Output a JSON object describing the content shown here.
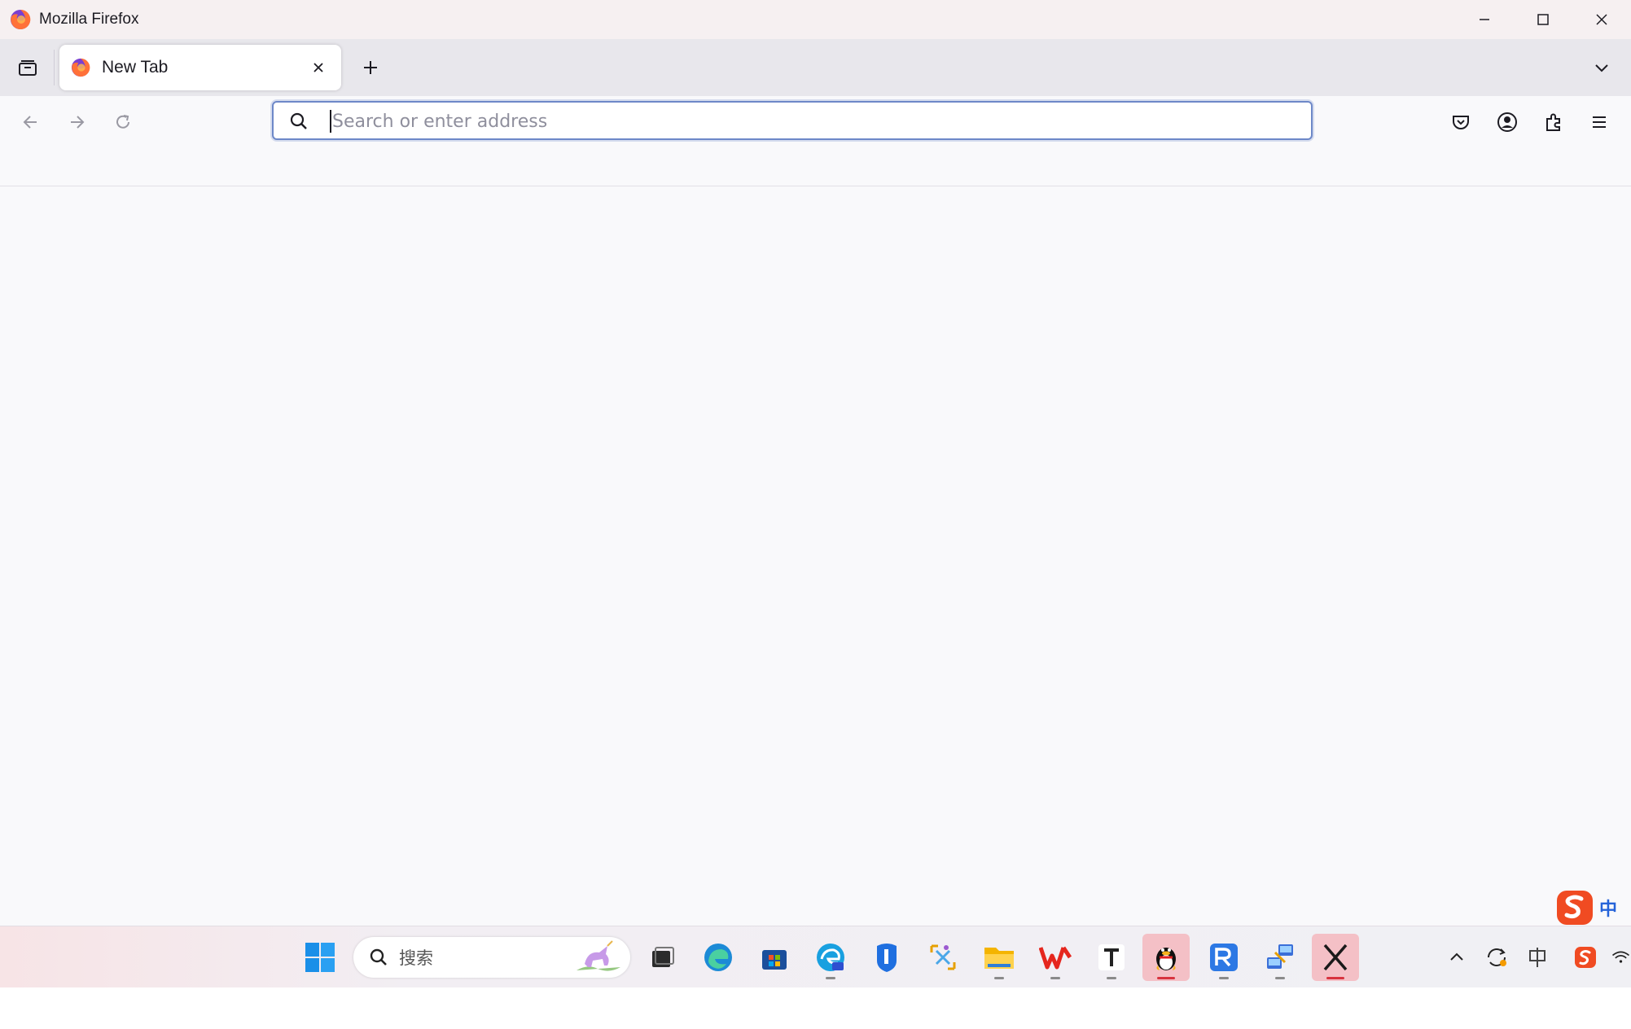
{
  "window": {
    "title": "Mozilla Firefox"
  },
  "tabs": [
    {
      "label": "New Tab",
      "active": true
    }
  ],
  "urlbar": {
    "placeholder": "Search or enter address",
    "value": ""
  },
  "taskbar": {
    "search_placeholder": "搜索",
    "apps": [
      {
        "name": "start",
        "icon": "windows-logo-icon"
      },
      {
        "name": "task-view",
        "icon": "task-view-icon"
      },
      {
        "name": "edge",
        "icon": "edge-icon"
      },
      {
        "name": "store",
        "icon": "store-icon"
      },
      {
        "name": "edge-ai",
        "icon": "edge-ai-icon"
      },
      {
        "name": "lenovo",
        "icon": "lenovo-icon"
      },
      {
        "name": "snipping",
        "icon": "snipping-icon"
      },
      {
        "name": "file-explorer",
        "icon": "folder-icon"
      },
      {
        "name": "wps",
        "icon": "wps-icon"
      },
      {
        "name": "typora",
        "icon": "typora-icon"
      },
      {
        "name": "qq",
        "icon": "qq-penguin-icon"
      },
      {
        "name": "rd",
        "icon": "remote-desktop-icon"
      },
      {
        "name": "network",
        "icon": "network-tool-icon"
      },
      {
        "name": "x-app",
        "icon": "x-icon"
      }
    ],
    "tray_ime_label": "中"
  },
  "colors": {
    "accent": "#6d88c8",
    "titlebar": "#f6f0f1",
    "tabstrip": "#e8e7ec",
    "content": "#f9f9fb",
    "active_task": "#f4c0c6"
  }
}
